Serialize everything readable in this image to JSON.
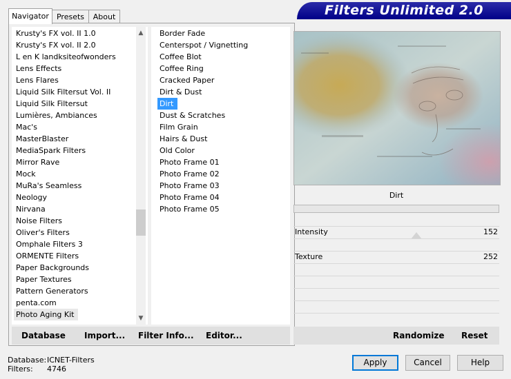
{
  "app": {
    "title": "Filters Unlimited 2.0"
  },
  "tabs": [
    {
      "label": "Navigator",
      "active": true
    },
    {
      "label": "Presets",
      "active": false
    },
    {
      "label": "About",
      "active": false
    }
  ],
  "categories": [
    "Krusty's FX vol. II 1.0",
    "Krusty's FX vol. II 2.0",
    "L en K landksiteofwonders",
    "Lens Effects",
    "Lens Flares",
    "Liquid Silk Filtersut Vol. II",
    "Liquid Silk Filtersut",
    "Lumières, Ambiances",
    "Mac's",
    "MasterBlaster",
    "MediaSpark Filters",
    "Mirror Rave",
    "Mock",
    "MuRa's Seamless",
    "Neology",
    "Nirvana",
    "Noise Filters",
    "Oliver's Filters",
    "Omphale Filters 3",
    "ORMENTE Filters",
    "Paper Backgrounds",
    "Paper Textures",
    "Pattern Generators",
    "penta.com",
    "Photo Aging Kit"
  ],
  "selected_category": "Photo Aging Kit",
  "filters": [
    "Border Fade",
    "Centerspot / Vignetting",
    "Coffee Blot",
    "Coffee Ring",
    "Cracked Paper",
    "Dirt & Dust",
    "Dirt",
    "Dust & Scratches",
    "Film Grain",
    "Hairs & Dust",
    "Old Color",
    "Photo Frame 01",
    "Photo Frame 02",
    "Photo Frame 03",
    "Photo Frame 04",
    "Photo Frame 05"
  ],
  "selected_filter": "Dirt",
  "left_buttons": {
    "database": "Database",
    "import": "Import...",
    "filter_info": "Filter Info...",
    "editor": "Editor..."
  },
  "filter_panel": {
    "name": "Dirt",
    "params": [
      {
        "label": "Intensity",
        "value": "152",
        "fraction": 0.596
      },
      {
        "label": "Texture",
        "value": "252",
        "fraction": 0.988
      }
    ],
    "randomize": "Randomize",
    "reset": "Reset"
  },
  "status": {
    "database_label": "Database:",
    "database_value": "ICNET-Filters",
    "filters_label": "Filters:",
    "filters_value": "4746"
  },
  "dialog_buttons": {
    "apply": "Apply",
    "cancel": "Cancel",
    "help": "Help"
  },
  "colors": {
    "banner": "#000088",
    "selection": "#3399ff"
  },
  "icons": {
    "scroll_up": "chevron-up-icon",
    "scroll_down": "chevron-down-icon"
  }
}
